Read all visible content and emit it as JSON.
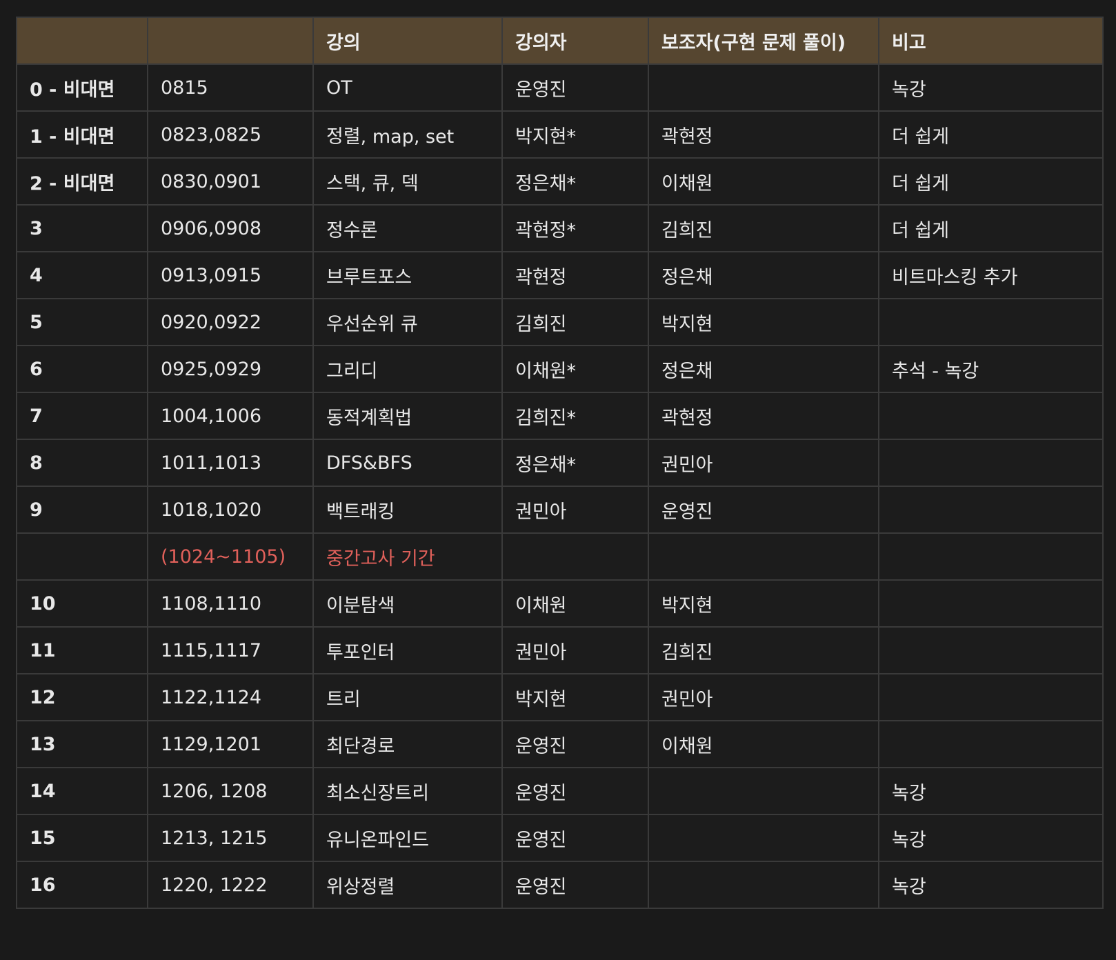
{
  "table": {
    "headers": [
      "",
      "",
      "강의",
      "강의자",
      "보조자(구현 문제 풀이)",
      "비고"
    ],
    "rows": [
      [
        "0 - 비대면",
        "0815",
        "OT",
        "운영진",
        "",
        "녹강"
      ],
      [
        "1 - 비대면",
        "0823,0825",
        "정렬, map, set",
        "박지현*",
        "곽현정",
        "더 쉽게"
      ],
      [
        "2 - 비대면",
        "0830,0901",
        "스택, 큐, 덱",
        "정은채*",
        "이채원",
        "더 쉽게"
      ],
      [
        "3",
        "0906,0908",
        "정수론",
        "곽현정*",
        "김희진",
        "더 쉽게"
      ],
      [
        "4",
        "0913,0915",
        "브루트포스",
        "곽현정",
        "정은채",
        "비트마스킹 추가"
      ],
      [
        "5",
        "0920,0922",
        "우선순위 큐",
        "김희진",
        "박지현",
        ""
      ],
      [
        "6",
        "0925,0929",
        "그리디",
        "이채원*",
        "정은채",
        "추석 - 녹강"
      ],
      [
        "7",
        "1004,1006",
        "동적계획법",
        "김희진*",
        "곽현정",
        ""
      ],
      [
        "8",
        "1011,1013",
        "DFS&BFS",
        "정은채*",
        "권민아",
        ""
      ],
      [
        "9",
        "1018,1020",
        "백트래킹",
        "권민아",
        "운영진",
        ""
      ],
      [
        "",
        "(1024~1105)",
        "중간고사 기간",
        "",
        "",
        ""
      ],
      [
        "10",
        "1108,1110",
        "이분탐색",
        "이채원",
        "박지현",
        ""
      ],
      [
        "11",
        "1115,1117",
        "투포인터",
        "권민아",
        "김희진",
        ""
      ],
      [
        "12",
        "1122,1124",
        "트리",
        "박지현",
        "권민아",
        ""
      ],
      [
        "13",
        "1129,1201",
        "최단경로",
        "운영진",
        "이채원",
        ""
      ],
      [
        "14",
        "1206, 1208",
        "최소신장트리",
        "운영진",
        "",
        "녹강"
      ],
      [
        "15",
        "1213, 1215",
        "유니온파인드",
        "운영진",
        "",
        "녹강"
      ],
      [
        "16",
        "1220, 1222",
        "위상정렬",
        "운영진",
        "",
        "녹강"
      ]
    ],
    "highlight_row_index": 10
  },
  "colors": {
    "background": "#1a1a1a",
    "header_background": "#564630",
    "highlight_text": "#e0605a",
    "border": "#3a3a3a"
  }
}
